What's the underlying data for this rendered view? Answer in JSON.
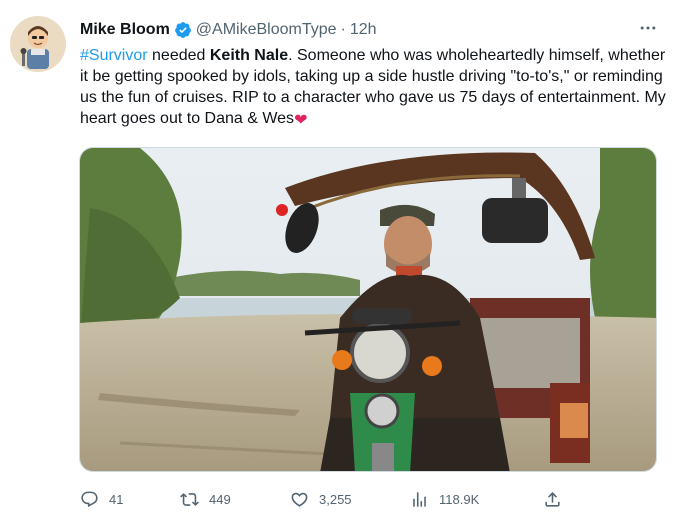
{
  "author": {
    "name": "Mike Bloom",
    "handle": "@AMikeBloomType",
    "separator": "·",
    "time": "12h"
  },
  "tweet": {
    "hashtag": "#Survivor",
    "seg1": " needed ",
    "bold": "Keith Nale",
    "seg2": ". Someone who was wholeheartedly himself, whether it be getting spooked by idols, taking up a side hustle driving \"to-to's,\" or reminding us the fun of cruises. RIP to a character who gave us 75 days of entertainment. My heart goes out to Dana & Wes",
    "emoji": "❤"
  },
  "actions": {
    "replies": "41",
    "retweets": "449",
    "likes": "3,255",
    "views": "118.9K"
  },
  "colors": {
    "accent": "#1d9bf0",
    "text": "#0f1419",
    "secondary": "#536471",
    "heart": "#e0245e"
  },
  "icons": [
    "verified-badge-icon",
    "more-options-icon",
    "reply-icon",
    "retweet-icon",
    "like-icon",
    "views-icon",
    "share-icon"
  ]
}
